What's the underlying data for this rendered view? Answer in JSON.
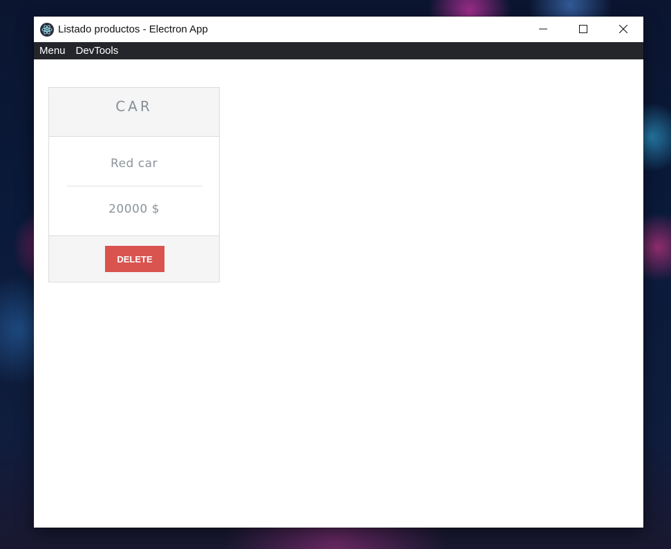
{
  "window": {
    "title": "Listado productos - Electron App",
    "app_icon": "electron-icon",
    "controls": {
      "minimize_icon": "minimize-icon",
      "maximize_icon": "maximize-icon",
      "close_icon": "close-icon"
    }
  },
  "menubar": {
    "items": [
      {
        "label": "Menu"
      },
      {
        "label": "DevTools"
      }
    ]
  },
  "products": [
    {
      "title": "CAR",
      "description": "Red car",
      "price": "20000 $",
      "delete_label": "DELETE"
    }
  ],
  "colors": {
    "menubar_bg": "#24262b",
    "card_header_bg": "#f5f5f5",
    "delete_button": "#d9534f",
    "muted_text": "#868e96"
  }
}
